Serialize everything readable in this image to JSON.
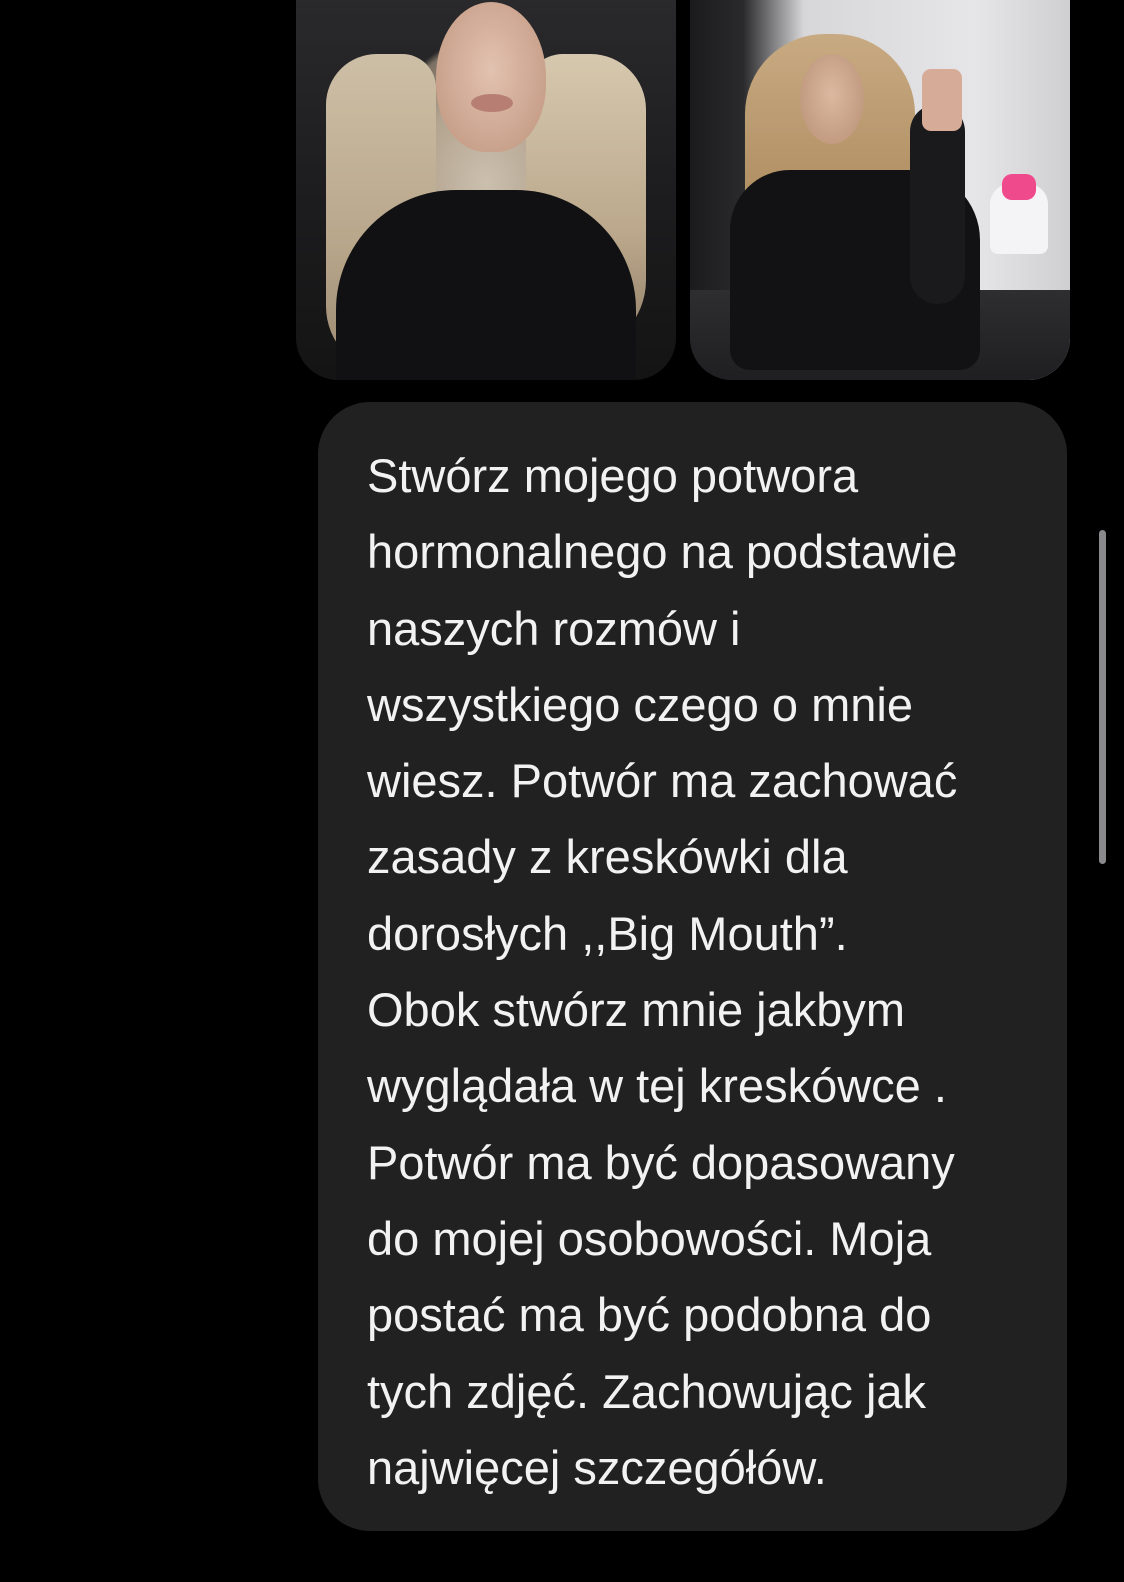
{
  "attachments": [
    {
      "kind": "photo",
      "icon": "photo-thumbnail-icon"
    },
    {
      "kind": "photo",
      "icon": "photo-thumbnail-icon"
    }
  ],
  "message": {
    "lines": [
      "Stwórz mojego potwora",
      "hormonalnego na podstawie",
      "naszych rozmów i",
      "wszystkiego czego o mnie",
      "wiesz. Potwór ma zachować",
      "zasady z kreskówki dla",
      "dorosłych ,,Big Mouth”.",
      "Obok stwórz mnie jakbym",
      "wyglądała w tej kreskówce .",
      "Potwór ma być dopasowany",
      "do mojej osobowości. Moja",
      "postać ma być podobna do",
      "tych zdjęć. Zachowując jak",
      "najwięcej szczegółów."
    ]
  },
  "colors": {
    "background": "#000000",
    "bubble": "#212121",
    "text": "#f2f2f2",
    "scrollbar": "#8a8a8c"
  }
}
